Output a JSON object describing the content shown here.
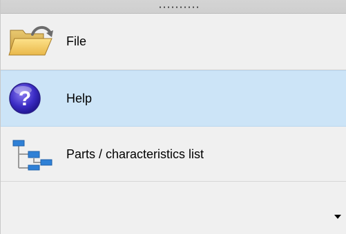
{
  "navigation_panel": {
    "items": [
      {
        "label": "File",
        "icon": "folder-open-icon",
        "selected": false
      },
      {
        "label": "Help",
        "icon": "help-question-icon",
        "selected": true
      },
      {
        "label": "Parts / characteristics list",
        "icon": "tree-hierarchy-icon",
        "selected": false
      }
    ],
    "colors": {
      "selected_background": "#cce4f7",
      "panel_background": "#f0f0f0",
      "grip_bar": "#d4d4d4"
    }
  }
}
